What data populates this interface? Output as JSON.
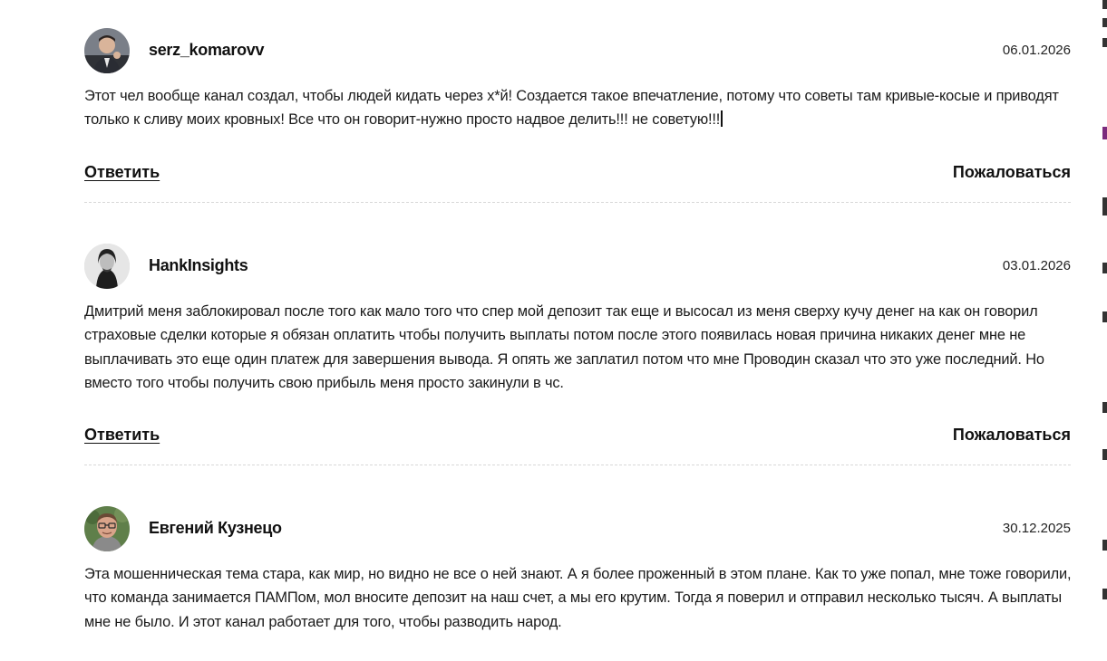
{
  "comments": [
    {
      "author": "serz_komarovv",
      "date": "06.01.2026",
      "text": "Этот чел вообще канал создал, чтобы людей кидать через х*й! Создается такое впечатление, потому что советы там кривые-косые и приводят только к сливу моих кровных! Все что он говорит-нужно просто надвое делить!!! не советую!!!",
      "reply_label": "Ответить",
      "report_label": "Пожаловаться"
    },
    {
      "author": "HankInsights",
      "date": "03.01.2026",
      "text": "Дмитрий меня заблокировал после того как мало того что спер мой депозит так еще и высосал из меня сверху кучу денег на как он говорил страховые сделки которые я обязан оплатить чтобы получить выплаты потом после этого появилась новая причина никаких денег мне не выплачивать это еще один платеж для завершения вывода. Я опять же заплатил потом что мне Проводин сказал что это уже последний. Но вместо того чтобы получить свою прибыль меня просто закинули в чс.",
      "reply_label": "Ответить",
      "report_label": "Пожаловаться"
    },
    {
      "author": "Евгений Кузнецо",
      "date": "30.12.2025",
      "text": "Эта мошенническая тема стара, как мир, но видно не все о ней знают. А я более проженный в этом плане. Как то уже попал, мне тоже говорили, что команда занимается ПАМПом, мол вносите депозит на наш счет, а мы его крутим. Тогда я поверил и отправил несколько тысяч. А выплаты мне не было. И этот канал работает для того, чтобы разводить народ."
    }
  ]
}
